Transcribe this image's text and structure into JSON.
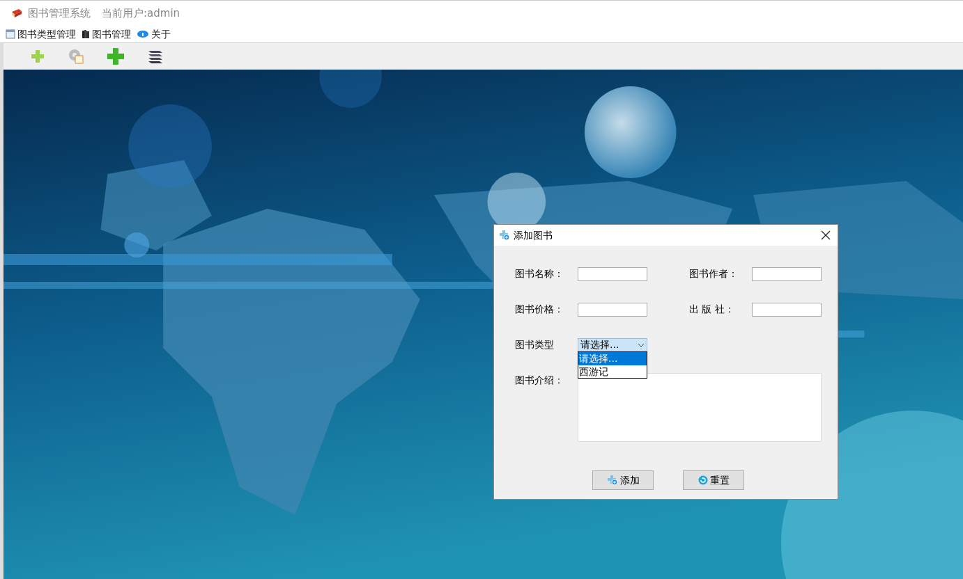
{
  "window": {
    "title": "图书管理系统",
    "current_user": "当前用户:admin"
  },
  "menu": [
    {
      "label": "图书类型管理"
    },
    {
      "label": "图书管理"
    },
    {
      "label": "关于"
    }
  ],
  "dialog": {
    "title": "添加图书",
    "fields": [
      {
        "label": "图书名称："
      },
      {
        "label": "图书作者："
      },
      {
        "label": "图书价格："
      },
      {
        "label": "出 版 社："
      }
    ],
    "type": {
      "label": "图书类型",
      "value": "请选择...",
      "expanded": true,
      "options": [
        {
          "label": "请选择...",
          "selected": true
        },
        {
          "label": "西游记",
          "selected": false
        }
      ]
    },
    "description": {
      "label": "图书介绍："
    },
    "buttons": [
      {
        "label": "添加",
        "kind": "add"
      },
      {
        "label": "重置",
        "kind": "reset"
      }
    ]
  }
}
